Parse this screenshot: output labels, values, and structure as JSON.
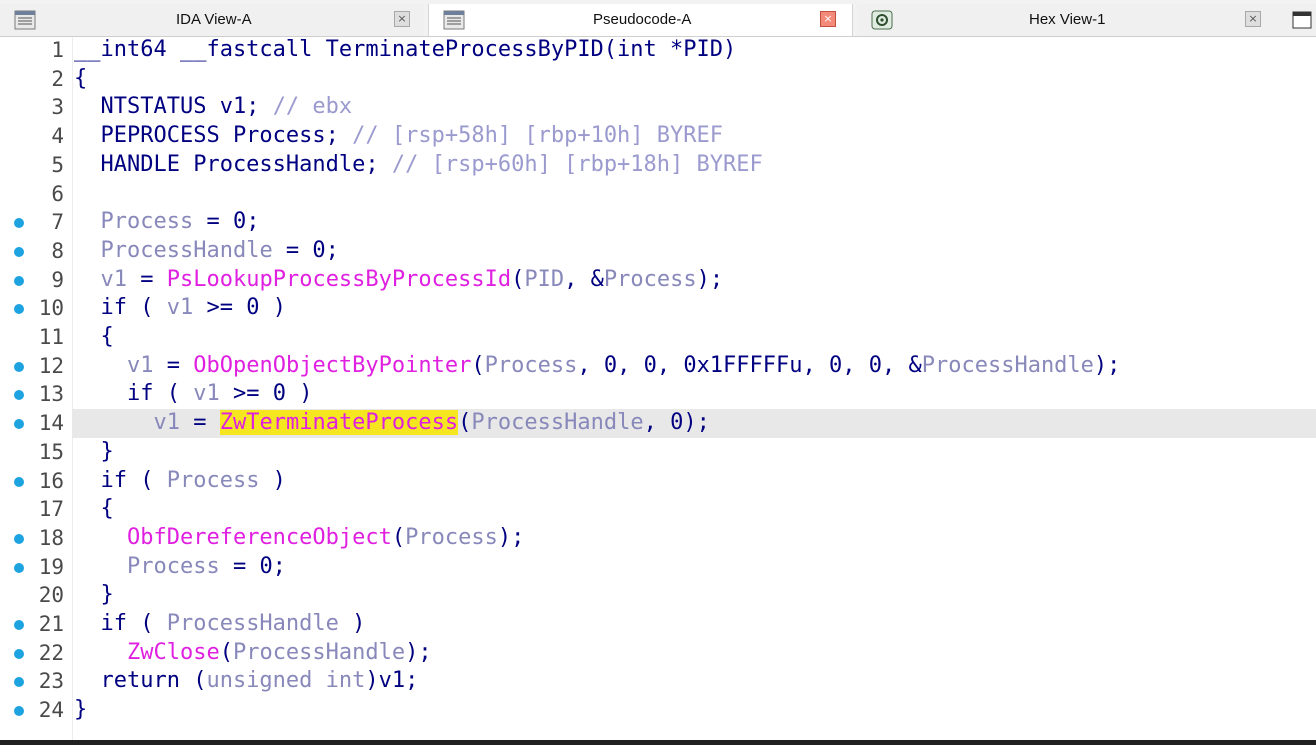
{
  "tabs": [
    {
      "label": "IDA View-A",
      "icon": "disassembly-view-icon",
      "active": false
    },
    {
      "label": "Pseudocode-A",
      "icon": "pseudocode-view-icon",
      "active": true
    },
    {
      "label": "Hex View-1",
      "icon": "hex-view-icon",
      "active": false
    }
  ],
  "close_glyph": "×",
  "colors": {
    "keyword": "#000080",
    "variable": "#8888bb",
    "function": "#e020e0",
    "comment": "#9a9acf",
    "highlight": "#f5e61f",
    "current_line": "#e8e8e8",
    "breakpoint_dot": "#1ca3e0"
  },
  "code": {
    "current_line": 14,
    "lines": [
      {
        "n": "1",
        "dot": false,
        "tokens": [
          {
            "t": "__int64 __fastcall TerminateProcessByPID(int *PID)",
            "c": "kw"
          }
        ]
      },
      {
        "n": "2",
        "dot": false,
        "tokens": [
          {
            "t": "{",
            "c": "kw"
          }
        ]
      },
      {
        "n": "3",
        "dot": false,
        "tokens": [
          {
            "t": "  NTSTATUS v1; ",
            "c": "kw"
          },
          {
            "t": "// ebx",
            "c": "cmt"
          }
        ]
      },
      {
        "n": "4",
        "dot": false,
        "tokens": [
          {
            "t": "  PEPROCESS Process; ",
            "c": "kw"
          },
          {
            "t": "// [rsp+58h] [rbp+10h] BYREF",
            "c": "cmt"
          }
        ]
      },
      {
        "n": "5",
        "dot": false,
        "tokens": [
          {
            "t": "  HANDLE ProcessHandle; ",
            "c": "kw"
          },
          {
            "t": "// [rsp+60h] [rbp+18h] BYREF",
            "c": "cmt"
          }
        ]
      },
      {
        "n": "6",
        "dot": false,
        "tokens": []
      },
      {
        "n": "7",
        "dot": true,
        "tokens": [
          {
            "t": "  ",
            "c": "kw"
          },
          {
            "t": "Process",
            "c": "var"
          },
          {
            "t": " = 0;",
            "c": "kw"
          }
        ]
      },
      {
        "n": "8",
        "dot": true,
        "tokens": [
          {
            "t": "  ",
            "c": "kw"
          },
          {
            "t": "ProcessHandle",
            "c": "var"
          },
          {
            "t": " = 0;",
            "c": "kw"
          }
        ]
      },
      {
        "n": "9",
        "dot": true,
        "tokens": [
          {
            "t": "  ",
            "c": "kw"
          },
          {
            "t": "v1",
            "c": "var"
          },
          {
            "t": " = ",
            "c": "kw"
          },
          {
            "t": "PsLookupProcessByProcessId",
            "c": "fn"
          },
          {
            "t": "(",
            "c": "kw"
          },
          {
            "t": "PID",
            "c": "var"
          },
          {
            "t": ", &",
            "c": "kw"
          },
          {
            "t": "Process",
            "c": "var"
          },
          {
            "t": ");",
            "c": "kw"
          }
        ]
      },
      {
        "n": "10",
        "dot": true,
        "tokens": [
          {
            "t": "  if ( ",
            "c": "kw"
          },
          {
            "t": "v1",
            "c": "var"
          },
          {
            "t": " >= 0 )",
            "c": "kw"
          }
        ]
      },
      {
        "n": "11",
        "dot": false,
        "tokens": [
          {
            "t": "  {",
            "c": "kw"
          }
        ]
      },
      {
        "n": "12",
        "dot": true,
        "tokens": [
          {
            "t": "    ",
            "c": "kw"
          },
          {
            "t": "v1",
            "c": "var"
          },
          {
            "t": " = ",
            "c": "kw"
          },
          {
            "t": "ObOpenObjectByPointer",
            "c": "fn"
          },
          {
            "t": "(",
            "c": "kw"
          },
          {
            "t": "Process",
            "c": "var"
          },
          {
            "t": ", 0, 0, 0x1FFFFFu, 0, 0, &",
            "c": "kw"
          },
          {
            "t": "ProcessHandle",
            "c": "var"
          },
          {
            "t": ");",
            "c": "kw"
          }
        ]
      },
      {
        "n": "13",
        "dot": true,
        "tokens": [
          {
            "t": "    if ( ",
            "c": "kw"
          },
          {
            "t": "v1",
            "c": "var"
          },
          {
            "t": " >= 0 )",
            "c": "kw"
          }
        ]
      },
      {
        "n": "14",
        "dot": true,
        "tokens": [
          {
            "t": "      ",
            "c": "kw"
          },
          {
            "t": "v1",
            "c": "var"
          },
          {
            "t": " = ",
            "c": "kw"
          },
          {
            "t": "ZwTerminateProcess",
            "c": "fn hl"
          },
          {
            "t": "(",
            "c": "kw"
          },
          {
            "t": "ProcessHandle",
            "c": "var"
          },
          {
            "t": ", 0);",
            "c": "kw"
          }
        ]
      },
      {
        "n": "15",
        "dot": false,
        "tokens": [
          {
            "t": "  }",
            "c": "kw"
          }
        ]
      },
      {
        "n": "16",
        "dot": true,
        "tokens": [
          {
            "t": "  if ( ",
            "c": "kw"
          },
          {
            "t": "Process",
            "c": "var"
          },
          {
            "t": " )",
            "c": "kw"
          }
        ]
      },
      {
        "n": "17",
        "dot": false,
        "tokens": [
          {
            "t": "  {",
            "c": "kw"
          }
        ]
      },
      {
        "n": "18",
        "dot": true,
        "tokens": [
          {
            "t": "    ",
            "c": "kw"
          },
          {
            "t": "ObfDereferenceObject",
            "c": "fn"
          },
          {
            "t": "(",
            "c": "kw"
          },
          {
            "t": "Process",
            "c": "var"
          },
          {
            "t": ");",
            "c": "kw"
          }
        ]
      },
      {
        "n": "19",
        "dot": true,
        "tokens": [
          {
            "t": "    ",
            "c": "kw"
          },
          {
            "t": "Process",
            "c": "var"
          },
          {
            "t": " = 0;",
            "c": "kw"
          }
        ]
      },
      {
        "n": "20",
        "dot": false,
        "tokens": [
          {
            "t": "  }",
            "c": "kw"
          }
        ]
      },
      {
        "n": "21",
        "dot": true,
        "tokens": [
          {
            "t": "  if ( ",
            "c": "kw"
          },
          {
            "t": "ProcessHandle",
            "c": "var"
          },
          {
            "t": " )",
            "c": "kw"
          }
        ]
      },
      {
        "n": "22",
        "dot": true,
        "tokens": [
          {
            "t": "    ",
            "c": "kw"
          },
          {
            "t": "ZwClose",
            "c": "fn"
          },
          {
            "t": "(",
            "c": "kw"
          },
          {
            "t": "ProcessHandle",
            "c": "var"
          },
          {
            "t": ");",
            "c": "kw"
          }
        ]
      },
      {
        "n": "23",
        "dot": true,
        "tokens": [
          {
            "t": "  return (",
            "c": "kw"
          },
          {
            "t": "unsigned int",
            "c": "var"
          },
          {
            "t": ")v1;",
            "c": "kw"
          }
        ]
      },
      {
        "n": "24",
        "dot": true,
        "tokens": [
          {
            "t": "}",
            "c": "kw"
          }
        ]
      }
    ]
  }
}
